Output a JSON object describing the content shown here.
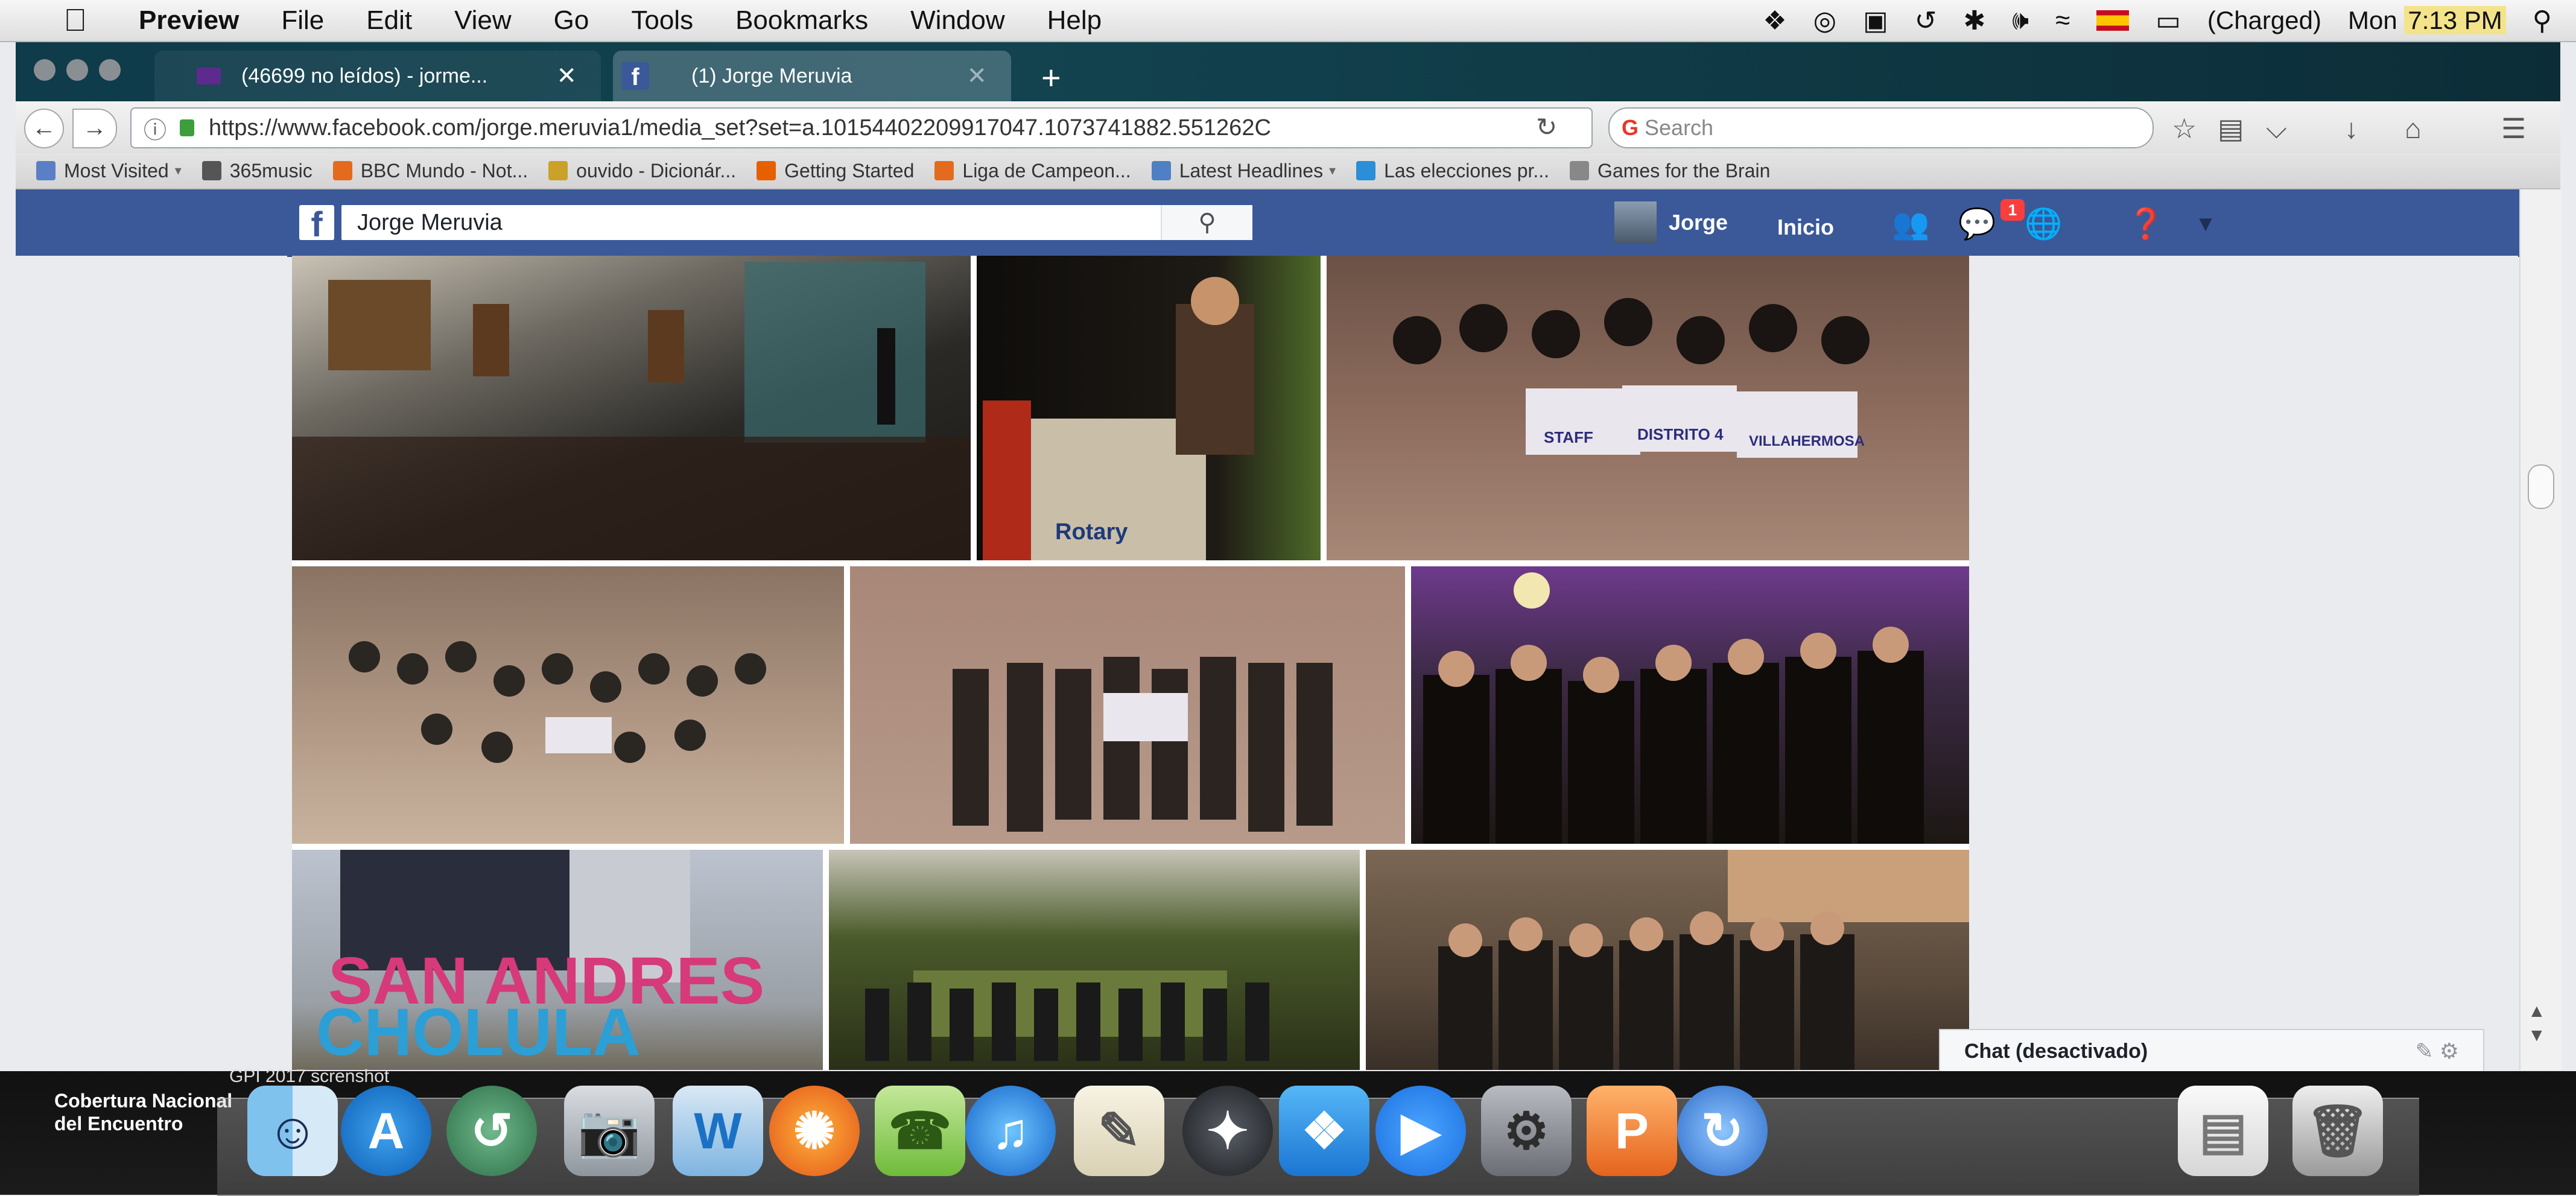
{
  "menubar": {
    "app_name": "Preview",
    "items": [
      "File",
      "Edit",
      "View",
      "Go",
      "Tools",
      "Bookmarks",
      "Window",
      "Help"
    ],
    "status_battery": "(Charged)",
    "clock_day": "Mon",
    "clock_time": "7:13 PM"
  },
  "tabs": [
    {
      "title": "(46699 no leídos) - jorme...",
      "close": "✕"
    },
    {
      "title": "(1) Jorge Meruvia",
      "close": "✕"
    }
  ],
  "new_tab": "+",
  "navbar": {
    "url": "https://www.facebook.com/jorge.meruvia1/media_set?set=a.10154402209917047.1073741882.551262C",
    "search_placeholder": "Search"
  },
  "bookmarks": [
    {
      "label": "Most Visited",
      "color": "#5a7fc4",
      "has_menu": true
    },
    {
      "label": "365music",
      "color": "#555555"
    },
    {
      "label": "BBC Mundo - Not...",
      "color": "#e46b1d"
    },
    {
      "label": "ouvido - Dicionár...",
      "color": "#c9a227"
    },
    {
      "label": "Getting Started",
      "color": "#e66000"
    },
    {
      "label": "Liga de Campeon...",
      "color": "#e46b1d"
    },
    {
      "label": "Latest Headlines",
      "color": "#4f7fc4",
      "has_menu": true
    },
    {
      "label": "Las elecciones pr...",
      "color": "#2a8fd6"
    },
    {
      "label": "Games for the Brain",
      "color": "#888888"
    }
  ],
  "facebook": {
    "logo": "f",
    "search_value": "Jorge Meruvia",
    "user_name": "Jorge",
    "home_label": "Inicio",
    "message_badge": "1"
  },
  "chat": {
    "label": "Chat (desactivado)"
  },
  "desktop": {
    "label": "Cobertura Nacional del Encuentro",
    "label2": "GPI 2017 screnshot"
  },
  "colors": {
    "facebook_blue": "#3b5998",
    "tab_bg": "#0f3b4a"
  }
}
